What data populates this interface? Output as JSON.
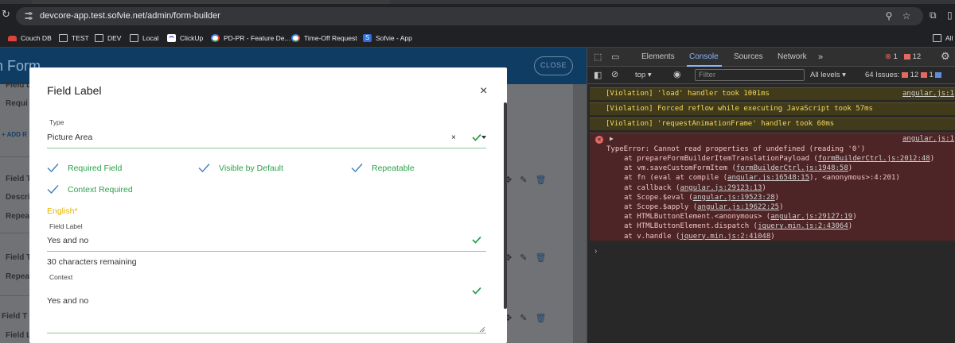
{
  "browser": {
    "url": "devcore-app.test.sofvie.net/admin/form-builder",
    "bookmarks": [
      {
        "label": "Couch DB",
        "icon": "couch-icon"
      },
      {
        "label": "TEST",
        "icon": "folder-icon"
      },
      {
        "label": "DEV",
        "icon": "folder-icon"
      },
      {
        "label": "Local",
        "icon": "folder-icon"
      },
      {
        "label": "ClickUp",
        "icon": "clickup-icon"
      },
      {
        "label": "PD-PR - Feature De...",
        "icon": "google-icon"
      },
      {
        "label": "Time-Off Request",
        "icon": "google-icon"
      },
      {
        "label": "Sofvie - App",
        "icon": "sofvie-icon"
      }
    ],
    "all_bookmarks": "All"
  },
  "page": {
    "title": "n Form",
    "close_button": "CLOSE",
    "bg_labels": [
      "Field L",
      "Requi",
      "+ ADD R",
      "Field T",
      "Descri",
      "Repea",
      "Field T",
      "Repea",
      "Field T",
      "Field L"
    ]
  },
  "modal": {
    "title": "Field Label",
    "type_label": "Type",
    "type_value": "Picture Area",
    "checkboxes": [
      {
        "label": "Required Field",
        "checked": true
      },
      {
        "label": "Visible by Default",
        "checked": true
      },
      {
        "label": "Repeatable",
        "checked": true
      },
      {
        "label": "Context Required",
        "checked": true
      }
    ],
    "language": "English*",
    "field_label_caption": "Field Label",
    "field_label_value": "Yes and no",
    "remaining": "30 characters remaining",
    "context_caption": "Context",
    "context_value": "Yes and no"
  },
  "devtools": {
    "tabs": [
      "Elements",
      "Console",
      "Sources",
      "Network"
    ],
    "active_tab": "Console",
    "error_count": "1",
    "issue_count": "12",
    "context": "top",
    "filter_placeholder": "Filter",
    "levels": "All levels",
    "issues_label": "64 Issues:",
    "issues_errors": "12",
    "issues_info": "1",
    "violations": [
      {
        "text": "[Violation] 'load' handler took 1001ms",
        "source": "angular.js:1"
      },
      {
        "text": "[Violation] Forced reflow while executing JavaScript took 57ms",
        "source": ""
      },
      {
        "text": "[Violation] 'requestAnimationFrame' handler took 60ms",
        "source": ""
      }
    ],
    "error": {
      "source": "angular.js:1",
      "message": "TypeError: Cannot read properties of undefined (reading '0')",
      "stack": [
        {
          "pre": "at prepareFormBuilderItemTranslationPayload (",
          "link": "formBuilderCtrl.js:2012:48",
          "post": ")"
        },
        {
          "pre": "at vm.saveCustomFormItem (",
          "link": "formBuilderCtrl.js:1948:58",
          "post": ")"
        },
        {
          "pre": "at fn (eval at compile (",
          "link": "angular.js:16548:15",
          "post": "), <anonymous>:4:201)"
        },
        {
          "pre": "at callback (",
          "link": "angular.js:29123:13",
          "post": ")"
        },
        {
          "pre": "at Scope.$eval (",
          "link": "angular.js:19523:28",
          "post": ")"
        },
        {
          "pre": "at Scope.$apply (",
          "link": "angular.js:19622:25",
          "post": ")"
        },
        {
          "pre": "at HTMLButtonElement.<anonymous> (",
          "link": "angular.js:29127:19",
          "post": ")"
        },
        {
          "pre": "at HTMLButtonElement.dispatch (",
          "link": "jquery.min.js:2:43064",
          "post": ")"
        },
        {
          "pre": "at v.handle (",
          "link": "jquery.min.js:2:41048",
          "post": ")"
        }
      ]
    },
    "colors": {
      "accent": "#8ab4f8",
      "error_bg": "#4e2526",
      "warn_bg": "#413b1c"
    }
  }
}
